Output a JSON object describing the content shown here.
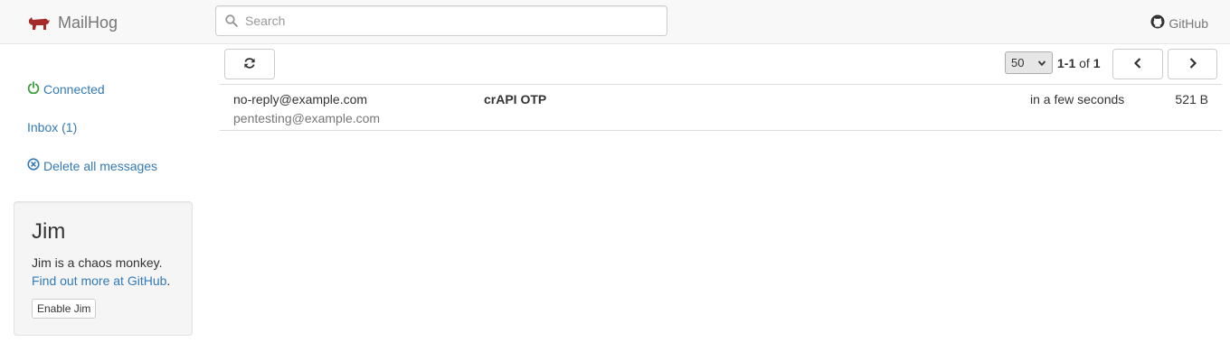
{
  "navbar": {
    "brand": "MailHog",
    "search_placeholder": "Search",
    "github_label": "GitHub"
  },
  "sidebar": {
    "connected_label": "Connected",
    "inbox_label": "Inbox (1)",
    "delete_all_label": "Delete all messages"
  },
  "jim": {
    "title": "Jim",
    "description": "Jim is a chaos monkey.",
    "link_text": "Find out more at GitHub",
    "link_suffix": ".",
    "button_label": "Enable Jim"
  },
  "toolbar": {
    "per_page": "50",
    "range": "1-1",
    "of_label": "of",
    "total": "1"
  },
  "messages": [
    {
      "from": "no-reply@example.com",
      "to": "pentesting@example.com",
      "subject": "crAPI OTP",
      "time": "in a few seconds",
      "size": "521 B"
    }
  ],
  "colors": {
    "link": "#337ab7",
    "connected": "#3c9d3c",
    "brand_icon": "#a52a2a"
  },
  "icons": {
    "brand": "pig-icon",
    "search": "search-icon",
    "github": "github-icon",
    "connected": "power-icon",
    "delete": "circle-x-icon",
    "refresh": "refresh-icon",
    "prev": "chevron-left-icon",
    "next": "chevron-right-icon",
    "select": "chevron-down-icon"
  }
}
